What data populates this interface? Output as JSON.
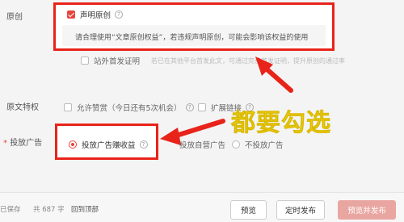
{
  "labels": {
    "original": "原创",
    "article_privilege": "原文特权",
    "ad_required_mark": "*",
    "ad": "投放广告"
  },
  "original_section": {
    "declare_original": "声明原创",
    "notice": "请合理使用“文章原创权益”，若违规声明原创，可能会影响该权益的使用",
    "first_publish": "站外首发证明",
    "first_publish_hint": "若已在其他平台首发此文，可通过完善首发证明，提升原创的通过率"
  },
  "privilege_section": {
    "allow_tip": "允许赞赏（今日还有5次机会）",
    "extend_link": "扩展链接"
  },
  "ad_section": {
    "option_earn": "投放广告赚收益",
    "option_self": "投放自营广告",
    "option_none": "不投放广告"
  },
  "annotation": {
    "text": "都要勾选",
    "color": "#e8231a",
    "text_color": "#f6d90f"
  },
  "footer": {
    "saved": "已保存",
    "word_count": "共 687 字",
    "back_to_top": "回到顶部",
    "preview": "预览",
    "scheduled": "定时发布",
    "publish": "预览并发布"
  }
}
